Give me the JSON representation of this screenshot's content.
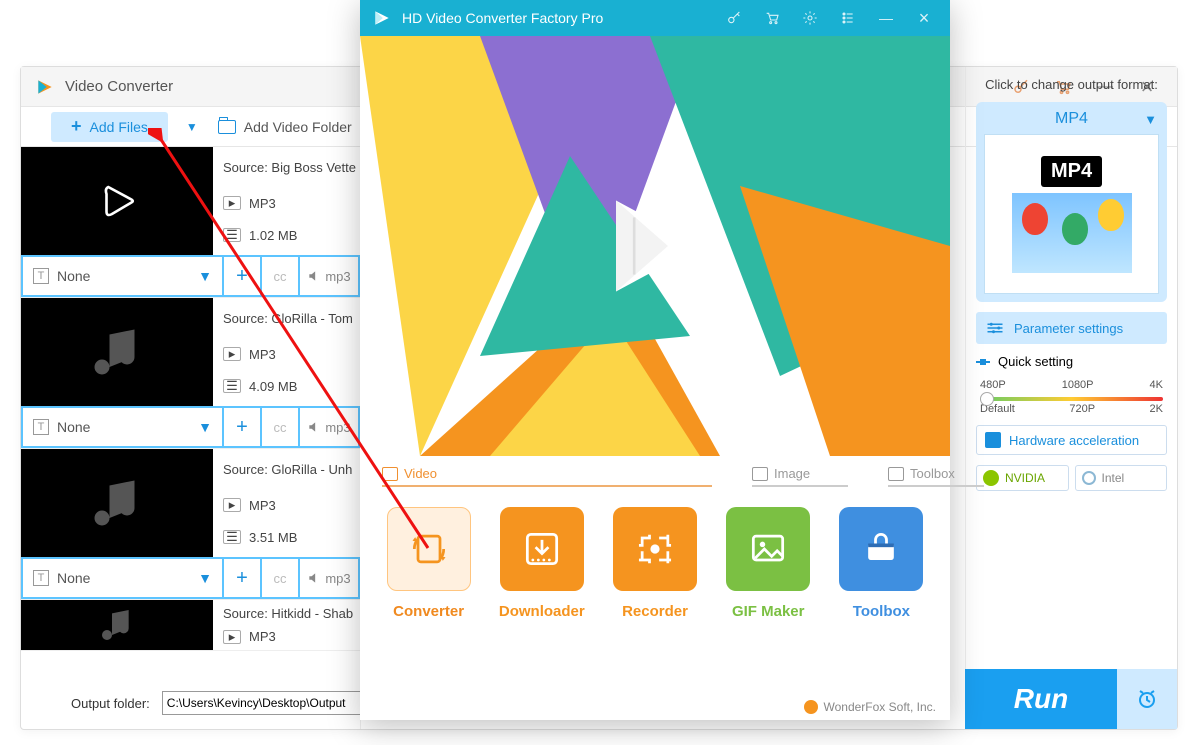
{
  "bg": {
    "title": "Video Converter",
    "add_files": "Add Files",
    "add_folder": "Add Video Folder",
    "files": [
      {
        "source": "Source: Big Boss Vette",
        "format": "MP3",
        "size": "1.02 MB",
        "subtitle": "None",
        "audio_fmt": "mp3",
        "thumb": "play"
      },
      {
        "source": "Source: GloRilla - Tom",
        "format": "MP3",
        "size": "4.09 MB",
        "subtitle": "None",
        "audio_fmt": "mp3",
        "thumb": "music"
      },
      {
        "source": "Source: GloRilla - Unh",
        "format": "MP3",
        "size": "3.51 MB",
        "subtitle": "None",
        "audio_fmt": "mp3",
        "thumb": "music"
      },
      {
        "source": "Source: Hitkidd - Shab",
        "format": "MP3",
        "size": "",
        "subtitle": "",
        "audio_fmt": "",
        "thumb": "music"
      }
    ],
    "output_label": "Output folder:",
    "output_path": "C:\\Users\\Kevincy\\Desktop\\Output"
  },
  "sidebar": {
    "hint": "Click to change output format:",
    "format": "MP4",
    "mp4_chip": "MP4",
    "param": "Parameter settings",
    "qs": "Quick setting",
    "scale_top": [
      "480P",
      "1080P",
      "4K"
    ],
    "scale_bot": [
      "Default",
      "720P",
      "2K"
    ],
    "hw": "Hardware acceleration",
    "nvidia": "NVIDIA",
    "intel": "Intel",
    "run": "Run"
  },
  "launcher": {
    "title": "HD Video Converter Factory Pro",
    "sections": {
      "video": "Video",
      "image": "Image",
      "toolbox": "Toolbox"
    },
    "tiles": {
      "converter": "Converter",
      "downloader": "Downloader",
      "recorder": "Recorder",
      "gif": "GIF Maker",
      "toolbox": "Toolbox"
    },
    "footer": "WonderFox Soft, Inc."
  }
}
